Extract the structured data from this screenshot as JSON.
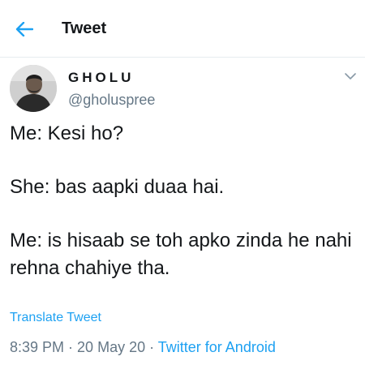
{
  "header": {
    "title": "Tweet",
    "back_icon": "arrow-left-icon",
    "accent_color": "#1da1f2"
  },
  "author": {
    "display_name": "GHOLU",
    "handle": "@gholuspree",
    "avatar_icon": "user-avatar"
  },
  "tweet": {
    "lines": [
      "Me: Kesi ho?",
      "She: bas aapki duaa hai.",
      "Me: is hisaab se toh apko zinda he nahi rehna chahiye tha."
    ],
    "translate_label": "Translate Tweet"
  },
  "meta": {
    "time": "8:39 PM",
    "separator": " · ",
    "date": "20 May 20",
    "source": "Twitter for Android"
  }
}
